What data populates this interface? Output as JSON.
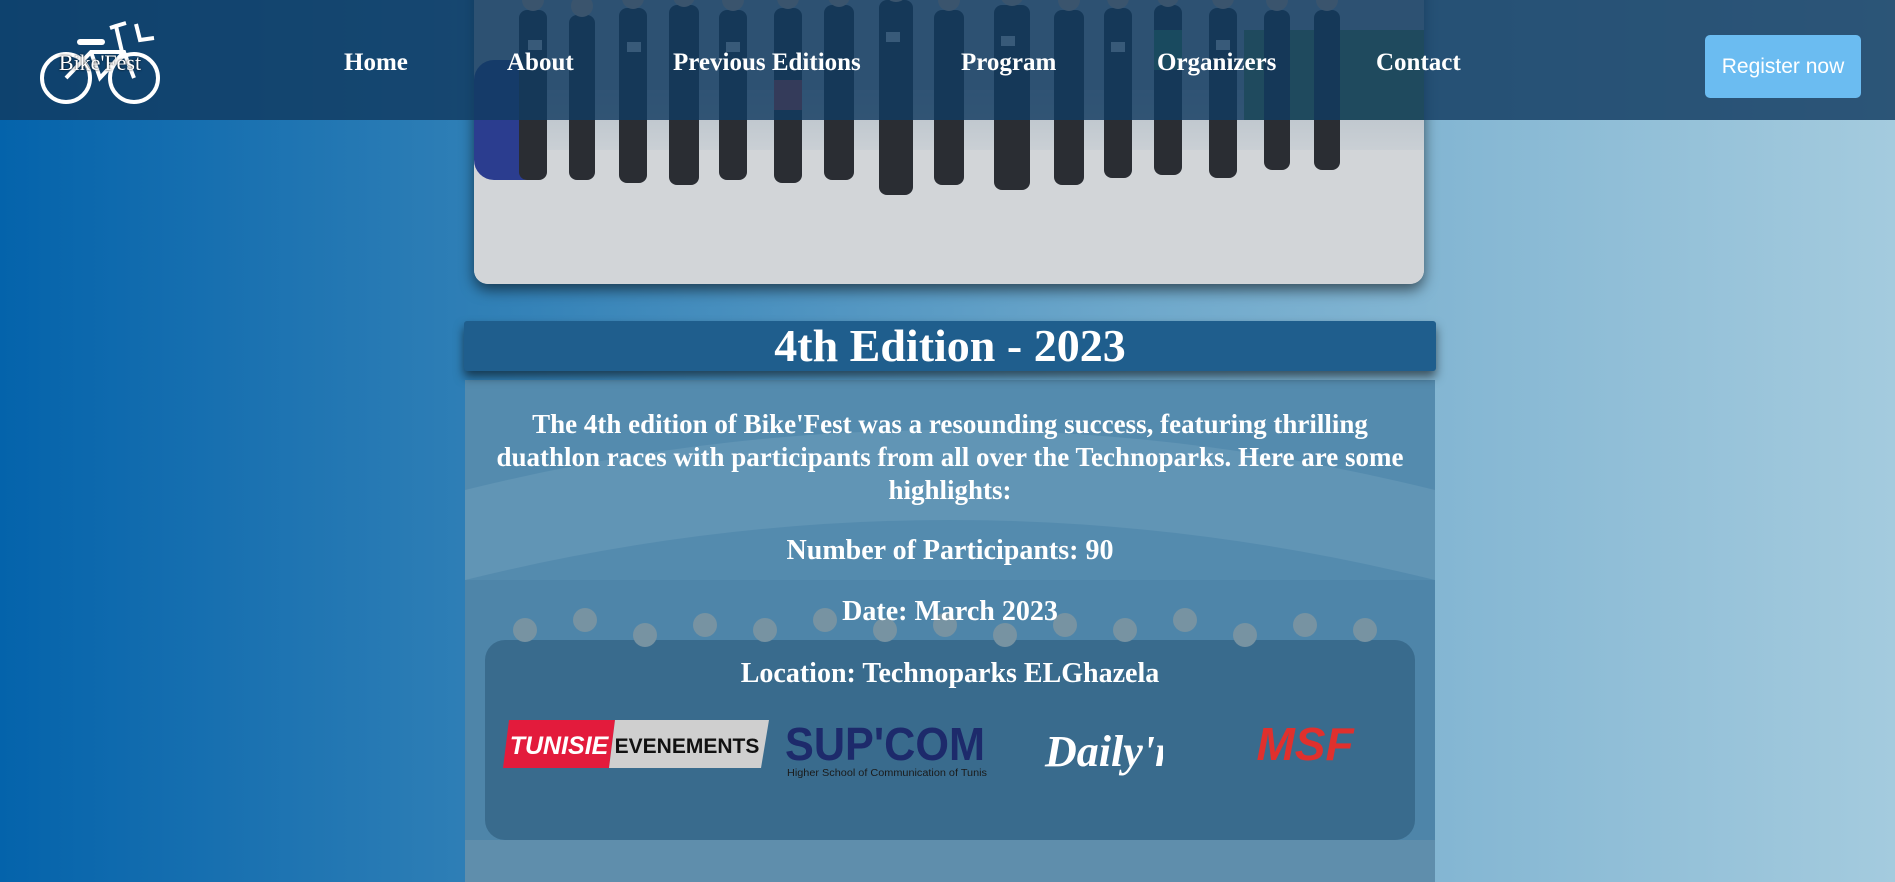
{
  "nav": {
    "logo_text": "Bike'Fest",
    "links": [
      {
        "label": "Home"
      },
      {
        "label": "About"
      },
      {
        "label": "Previous Editions"
      },
      {
        "label": "Program"
      },
      {
        "label": "Organizers"
      },
      {
        "label": "Contact"
      }
    ],
    "register_label": "Register now"
  },
  "hero": {
    "image": "group-photo"
  },
  "edition": {
    "title": "4th Edition - 2023",
    "intro": "The 4th edition of Bike'Fest was a resounding success, featuring thrilling duathlon races with participants from all over the Technoparks. Here are some highlights:",
    "participants": "Number of Participants: 90",
    "date": "Date: March 2023",
    "location": "Location: Technoparks ELGhazela"
  },
  "sponsors": {
    "tunisie_1": "TUNISIE",
    "tunisie_2": "EVENEMENTS",
    "supcom_1": "SUP'COM",
    "supcom_2": "Higher School of Communication of Tunis",
    "dailyn": "Daily'n",
    "msf": "MSF"
  },
  "colors": {
    "navbar": "#113b60",
    "register_button": "#6bbcf1",
    "banner": "#1f5e8d",
    "tunisie_red": "#e31b3c",
    "supcom_blue": "#1d2a6b",
    "supcom_red": "#e21f26",
    "msf_red": "#e0302d"
  }
}
